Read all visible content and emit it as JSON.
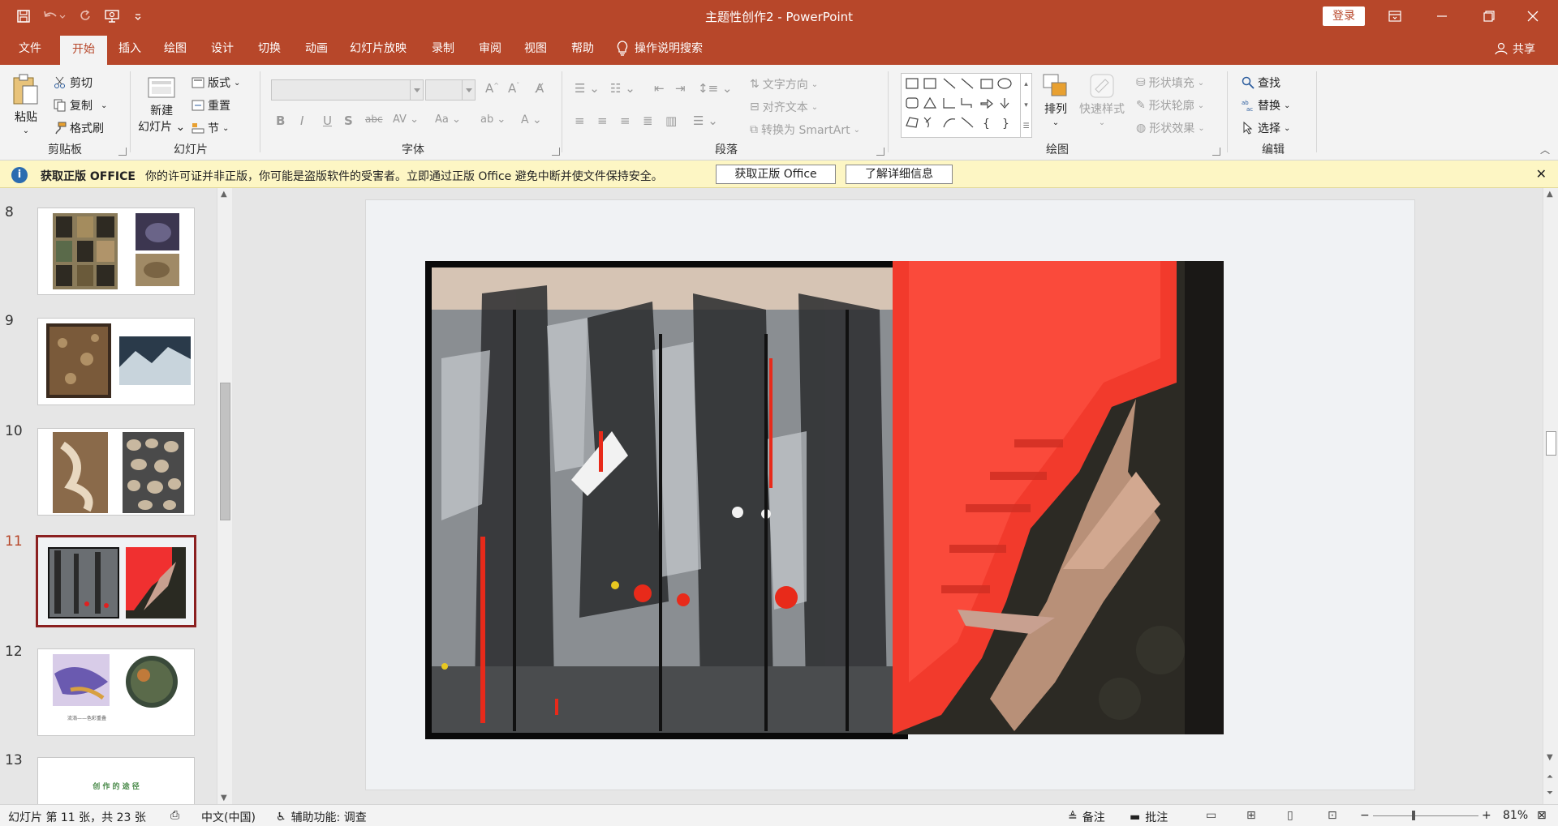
{
  "window": {
    "title": "主题性创作2  -  PowerPoint",
    "login_label": "登录"
  },
  "tabs": [
    {
      "label": "文件"
    },
    {
      "label": "开始"
    },
    {
      "label": "插入"
    },
    {
      "label": "绘图"
    },
    {
      "label": "设计"
    },
    {
      "label": "切换"
    },
    {
      "label": "动画"
    },
    {
      "label": "幻灯片放映"
    },
    {
      "label": "录制"
    },
    {
      "label": "审阅"
    },
    {
      "label": "视图"
    },
    {
      "label": "帮助"
    }
  ],
  "tell_me": "操作说明搜索",
  "share_label": "共享",
  "ribbon": {
    "clipboard": {
      "paste": "粘贴",
      "cut": "剪切",
      "copy": "复制",
      "format_painter": "格式刷",
      "group": "剪贴板"
    },
    "slides": {
      "new_slide_1": "新建",
      "new_slide_2": "幻灯片",
      "layout": "版式",
      "reset": "重置",
      "section": "节",
      "group": "幻灯片"
    },
    "font": {
      "group": "字体"
    },
    "paragraph": {
      "text_direction": "文字方向",
      "align_text": "对齐文本",
      "smartart": "转换为 SmartArt",
      "group": "段落"
    },
    "drawing": {
      "arrange": "排列",
      "quick_styles": "快速样式",
      "fill": "形状填充",
      "outline": "形状轮廓",
      "effects": "形状效果",
      "group": "绘图"
    },
    "editing": {
      "find": "查找",
      "replace": "替换",
      "select": "选择",
      "group": "编辑"
    }
  },
  "notification": {
    "title": "获取正版 OFFICE",
    "message": "你的许可证并非正版，你可能是盗版软件的受害者。立即通过正版 Office 避免中断并使文件保持安全。",
    "button1": "获取正版 Office",
    "button2": "了解详细信息"
  },
  "slides": [
    {
      "num": "8"
    },
    {
      "num": "9"
    },
    {
      "num": "10"
    },
    {
      "num": "11"
    },
    {
      "num": "12"
    },
    {
      "num": "13"
    }
  ],
  "slide12_caption_left": "流淌——色彩重叠",
  "slide13_title": "创 作 的 途 径",
  "status": {
    "slide_pos": "幻灯片 第 11 张，共 23 张",
    "language": "中文(中国)",
    "accessibility": "辅助功能: 调查",
    "notes": "备注",
    "comments": "批注",
    "zoom": "81%"
  },
  "colors": {
    "accent": "#b7472a",
    "ribbon_bg": "#f3f3f3",
    "notify_bg": "#fdf6c4",
    "active_thumb_border": "#8b2020"
  },
  "icons": [
    "save-icon",
    "undo-icon",
    "redo-icon",
    "present-icon",
    "customize-icon",
    "minimize-icon",
    "restore-icon",
    "maximize-icon",
    "close-icon",
    "lightbulb-icon",
    "person-icon",
    "info-icon"
  ]
}
